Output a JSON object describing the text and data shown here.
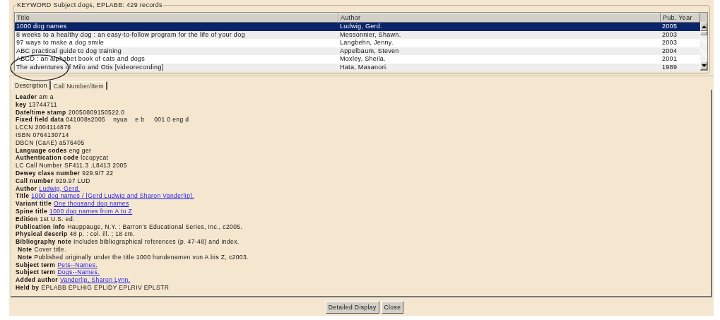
{
  "results": {
    "legend": "KEYWORD Subject dogs, EPLABB: 429 records",
    "columns": [
      "Title",
      "Author",
      "Pub. Year"
    ],
    "rows": [
      {
        "title": "1000 dog names",
        "author": "Ludwig, Gerd.",
        "year": "2005",
        "selected": true
      },
      {
        "title": "8 weeks to a healthy dog : an easy-to-follow program for the life of your dog",
        "author": "Messonnier, Shawn.",
        "year": "2003",
        "selected": false
      },
      {
        "title": "97 ways to make a dog smile",
        "author": "Langbehn, Jenny.",
        "year": "2003",
        "selected": false
      },
      {
        "title": "ABC practical guide to dog training",
        "author": "Appelbaum, Steven",
        "year": "2004",
        "selected": false
      },
      {
        "title": "ABCD : an alphabet book of cats and dogs",
        "author": "Moxley, Sheila.",
        "year": "2001",
        "selected": false
      },
      {
        "title": "The adventures of Milo and Otis [videorecording]",
        "author": "Hata, Masanori.",
        "year": "1989",
        "selected": false
      }
    ]
  },
  "tabs": [
    {
      "label": "Description",
      "selected": true
    },
    {
      "label": "Call Number/Item",
      "selected": false
    }
  ],
  "description": [
    {
      "label": "Leader",
      "value": "am a",
      "bold": true,
      "link": false
    },
    {
      "label": "key",
      "value": "13744711",
      "bold": true,
      "link": false
    },
    {
      "label": "Date/time stamp",
      "value": "20050809150522.0",
      "bold": true,
      "link": false
    },
    {
      "label": "Fixed field data",
      "value": "041008s2005    nyua    e b     001 0 eng d",
      "bold": true,
      "link": false
    },
    {
      "label": "LCCN",
      "value": "2004114878",
      "bold": false,
      "link": false
    },
    {
      "label": "ISBN",
      "value": "0764130714",
      "bold": false,
      "link": false
    },
    {
      "label": "DBCN (CaAE)",
      "value": "a576405",
      "bold": false,
      "link": false
    },
    {
      "label": "Language codes",
      "value": "eng ger",
      "bold": true,
      "link": false
    },
    {
      "label": "Authentication code",
      "value": "lccopycat",
      "bold": true,
      "link": false
    },
    {
      "label": "LC Call Number",
      "value": "SF411.3 .L8413 2005",
      "bold": false,
      "link": false
    },
    {
      "label": "Dewey class number",
      "value": "929.9/7 22",
      "bold": true,
      "link": false
    },
    {
      "label": "Call number",
      "value": "929.97 LUD",
      "bold": true,
      "link": false
    },
    {
      "label": "Author",
      "value": "Ludwig, Gerd.",
      "bold": true,
      "link": true
    },
    {
      "label": "Title",
      "value": "1000 dog names / [Gerd Ludwig and Sharon Vanderlip].",
      "bold": true,
      "link": true
    },
    {
      "label": "Variant title",
      "value": "One thousand dog names",
      "bold": true,
      "link": true
    },
    {
      "label": "Spine title",
      "value": "1000 dog names from A to Z",
      "bold": true,
      "link": true
    },
    {
      "label": "Edition",
      "value": "1st U.S. ed.",
      "bold": true,
      "link": false
    },
    {
      "label": "Publication info",
      "value": "Hauppauge, N.Y. : Barron's Educational Series, Inc., c2005.",
      "bold": true,
      "link": false
    },
    {
      "label": "Physical descrip",
      "value": "48 p. : col. ill. ; 18 cm.",
      "bold": true,
      "link": false
    },
    {
      "label": "Bibliography note",
      "value": "Includes bibliographical references (p. 47-48) and index.",
      "bold": true,
      "link": false
    },
    {
      "label": "Note",
      "value": "Cover title.",
      "bold": true,
      "link": false,
      "indented": true
    },
    {
      "label": "Note",
      "value": "Published originally under the title 1000 hundenamen von A bis Z, c2003.",
      "bold": true,
      "link": false,
      "indented": true
    },
    {
      "label": "Subject term",
      "value": "Pets--Names.",
      "bold": true,
      "link": true
    },
    {
      "label": "Subject term",
      "value": "Dogs--Names.",
      "bold": true,
      "link": true
    },
    {
      "label": "Added author",
      "value": "Vanderlip, Sharon Lynn.",
      "bold": true,
      "link": true
    },
    {
      "label": "Held by",
      "value": "EPLABB EPLHIG EPLIDY EPLRIV EPLSTR",
      "bold": true,
      "link": false
    }
  ],
  "buttons": [
    "Detailed Display",
    "Close"
  ]
}
